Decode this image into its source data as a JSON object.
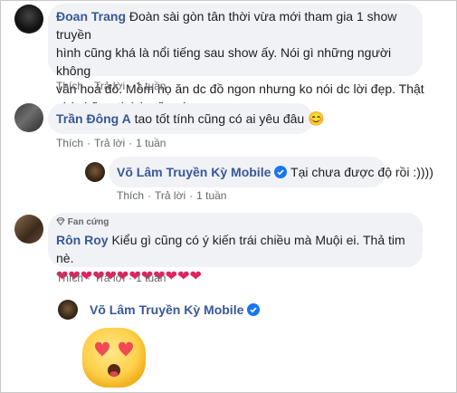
{
  "comments": [
    {
      "author": "Đoan Trang",
      "text": "Đoàn sài gòn tân thời vừa mới tham gia 1 show truyền hình cũng khá là nổi tiếng sau show ấy. Nói gì những người không văn hoá đó. Mồm họ ăn dc đồ ngon nhưng ko nói dc lời đẹp. Thật phí những thứ họ ăn vào...",
      "line1": "Đoàn sài gòn tân thời vừa mới tham gia 1 show truyền",
      "line2": "hình cũng khá là nổi tiếng sau show ấy. Nói gì những người không",
      "line3": "văn hoá đó. Mồm họ ăn dc đồ ngon nhưng ko nói dc lời đẹp. Thật",
      "line4": "phí những thứ họ ăn vào...",
      "like": "Thích",
      "reply": "Trả lời",
      "time": "1 tuần"
    },
    {
      "author": "Trần Đông A",
      "text": "tao tốt tính cũng có ai yêu đâu",
      "emoji": "😊",
      "like": "Thích",
      "reply": "Trả lời",
      "time": "1 tuần"
    },
    {
      "author": "Võ Lâm Truyền Kỳ Mobile",
      "text": "Tại chưa được độ rồi :))))",
      "like": "Thích",
      "reply": "Trả lời",
      "time": "1 tuần"
    },
    {
      "badge": "Fan cứng",
      "author": "Rôn Roy",
      "text": "Kiểu gì cũng có ý kiến trái chiều mà Muội ei. Thả tim nè.",
      "hearts": "❤❤❤❤❤❤❤❤❤❤❤❤",
      "like": "Thích",
      "reply": "Trả lời",
      "time": "1 tuần"
    },
    {
      "author": "Võ Lâm Truyền Kỳ Mobile",
      "sticker": "heart-eyes-emoji"
    }
  ],
  "colors": {
    "name": "#385898",
    "bubble": "#f0f2f5",
    "meta": "#65676b",
    "verified": "#1877f2",
    "heart": "#e0245e"
  }
}
